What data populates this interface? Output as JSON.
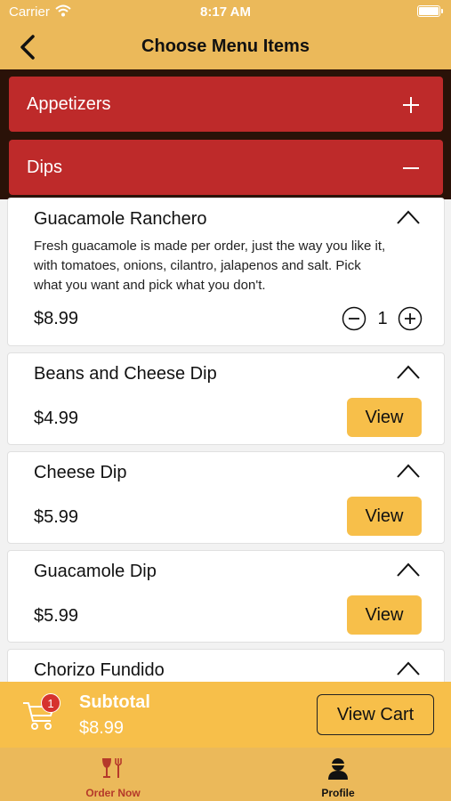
{
  "status_bar": {
    "carrier": "Carrier",
    "time": "8:17 AM"
  },
  "nav": {
    "title": "Choose Menu Items",
    "back_icon": "chevron-left-icon"
  },
  "categories": [
    {
      "label": "Appetizers",
      "toggle": "+",
      "toggle_icon": "plus-icon"
    },
    {
      "label": "Dips",
      "toggle": "−",
      "toggle_icon": "minus-icon"
    }
  ],
  "items": [
    {
      "name": "Guacamole Ranchero",
      "description": "Fresh guacamole is made per order, just the way you like it, with tomatoes, onions, cilantro, jalapenos and salt. Pick what you want and pick what you don't.",
      "price": "$8.99",
      "quantity": "1"
    },
    {
      "name": "Beans and Cheese Dip",
      "price": "$4.99",
      "action_label": "View"
    },
    {
      "name": "Cheese Dip",
      "price": "$5.99",
      "action_label": "View"
    },
    {
      "name": "Guacamole Dip",
      "price": "$5.99",
      "action_label": "View"
    },
    {
      "name": "Chorizo Fundido"
    }
  ],
  "cart": {
    "badge_count": "1",
    "subtotal_label": "Subtotal",
    "subtotal_value": "$8.99",
    "view_cart_label": "View Cart",
    "icon": "cart-icon"
  },
  "tabs": [
    {
      "label": "Order Now",
      "icon": "dining-icon",
      "active": true,
      "color": "#b5392a"
    },
    {
      "label": "Profile",
      "icon": "person-icon",
      "active": false,
      "color": "#111111"
    }
  ],
  "colors": {
    "brand": "#ebb95a",
    "accent": "#f7bf4a",
    "category_red": "#be2a2a",
    "badge": "#d6332e"
  }
}
